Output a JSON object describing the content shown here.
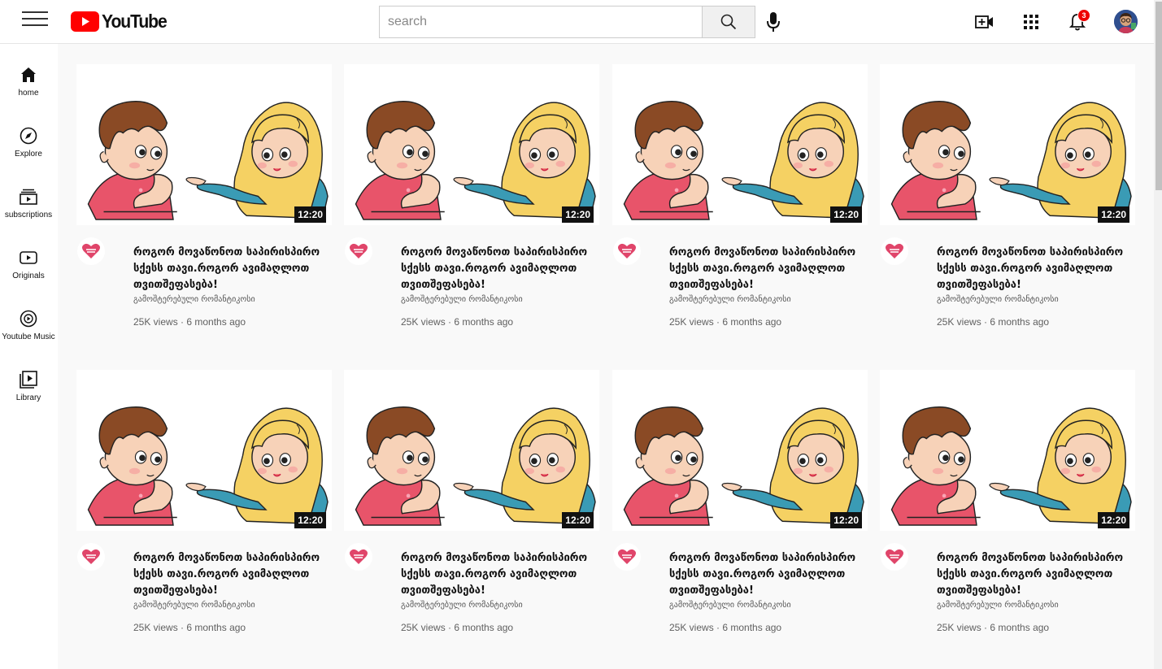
{
  "header": {
    "logo_text": "YouTube",
    "search_placeholder": "search",
    "notification_count": "3"
  },
  "sidebar": {
    "items": [
      {
        "label": "home",
        "icon": "home-icon"
      },
      {
        "label": "Explore",
        "icon": "compass-icon"
      },
      {
        "label": "subscriptions",
        "icon": "subscriptions-icon"
      },
      {
        "label": "Originals",
        "icon": "originals-icon"
      },
      {
        "label": "Youtube Music",
        "icon": "music-icon"
      },
      {
        "label": "Library",
        "icon": "library-icon"
      }
    ]
  },
  "videos": [
    {
      "title": "როგორ მოვაწონოთ საპირისპირო სქესს თავი.როგორ ავიმაღლოთ თვითშეფასება!",
      "channel": "გამოშტერებული რომანტიკოსი",
      "views": "25K views",
      "age": "6 months ago",
      "duration": "12:20"
    },
    {
      "title": "როგორ მოვაწონოთ საპირისპირო სქესს თავი.როგორ ავიმაღლოთ თვითშეფასება!",
      "channel": "გამოშტერებული რომანტიკოსი",
      "views": "25K views",
      "age": "6 months ago",
      "duration": "12:20"
    },
    {
      "title": "როგორ მოვაწონოთ საპირისპირო სქესს თავი.როგორ ავიმაღლოთ თვითშეფასება!",
      "channel": "გამოშტერებული რომანტიკოსი",
      "views": "25K views",
      "age": "6 months ago",
      "duration": "12:20"
    },
    {
      "title": "როგორ მოვაწონოთ საპირისპირო სქესს თავი.როგორ ავიმაღლოთ თვითშეფასება!",
      "channel": "გამოშტერებული რომანტიკოსი",
      "views": "25K views",
      "age": "6 months ago",
      "duration": "12:20"
    },
    {
      "title": "როგორ მოვაწონოთ საპირისპირო სქესს თავი.როგორ ავიმაღლოთ თვითშეფასება!",
      "channel": "გამოშტერებული რომანტიკოსი",
      "views": "25K views",
      "age": "6 months ago",
      "duration": "12:20"
    },
    {
      "title": "როგორ მოვაწონოთ საპირისპირო სქესს თავი.როგორ ავიმაღლოთ თვითშეფასება!",
      "channel": "გამოშტერებული რომანტიკოსი",
      "views": "25K views",
      "age": "6 months ago",
      "duration": "12:20"
    },
    {
      "title": "როგორ მოვაწონოთ საპირისპირო სქესს თავი.როგორ ავიმაღლოთ თვითშეფასება!",
      "channel": "გამოშტერებული რომანტიკოსი",
      "views": "25K views",
      "age": "6 months ago",
      "duration": "12:20"
    },
    {
      "title": "როგორ მოვაწონოთ საპირისპირო სქესს თავი.როგორ ავიმაღლოთ თვითშეფასება!",
      "channel": "გამოშტერებული რომანტიკოსი",
      "views": "25K views",
      "age": "6 months ago",
      "duration": "12:20"
    }
  ],
  "colors": {
    "brand_red": "#ff0000",
    "badge_red": "#e00000",
    "channel_pink": "#e0456a"
  }
}
